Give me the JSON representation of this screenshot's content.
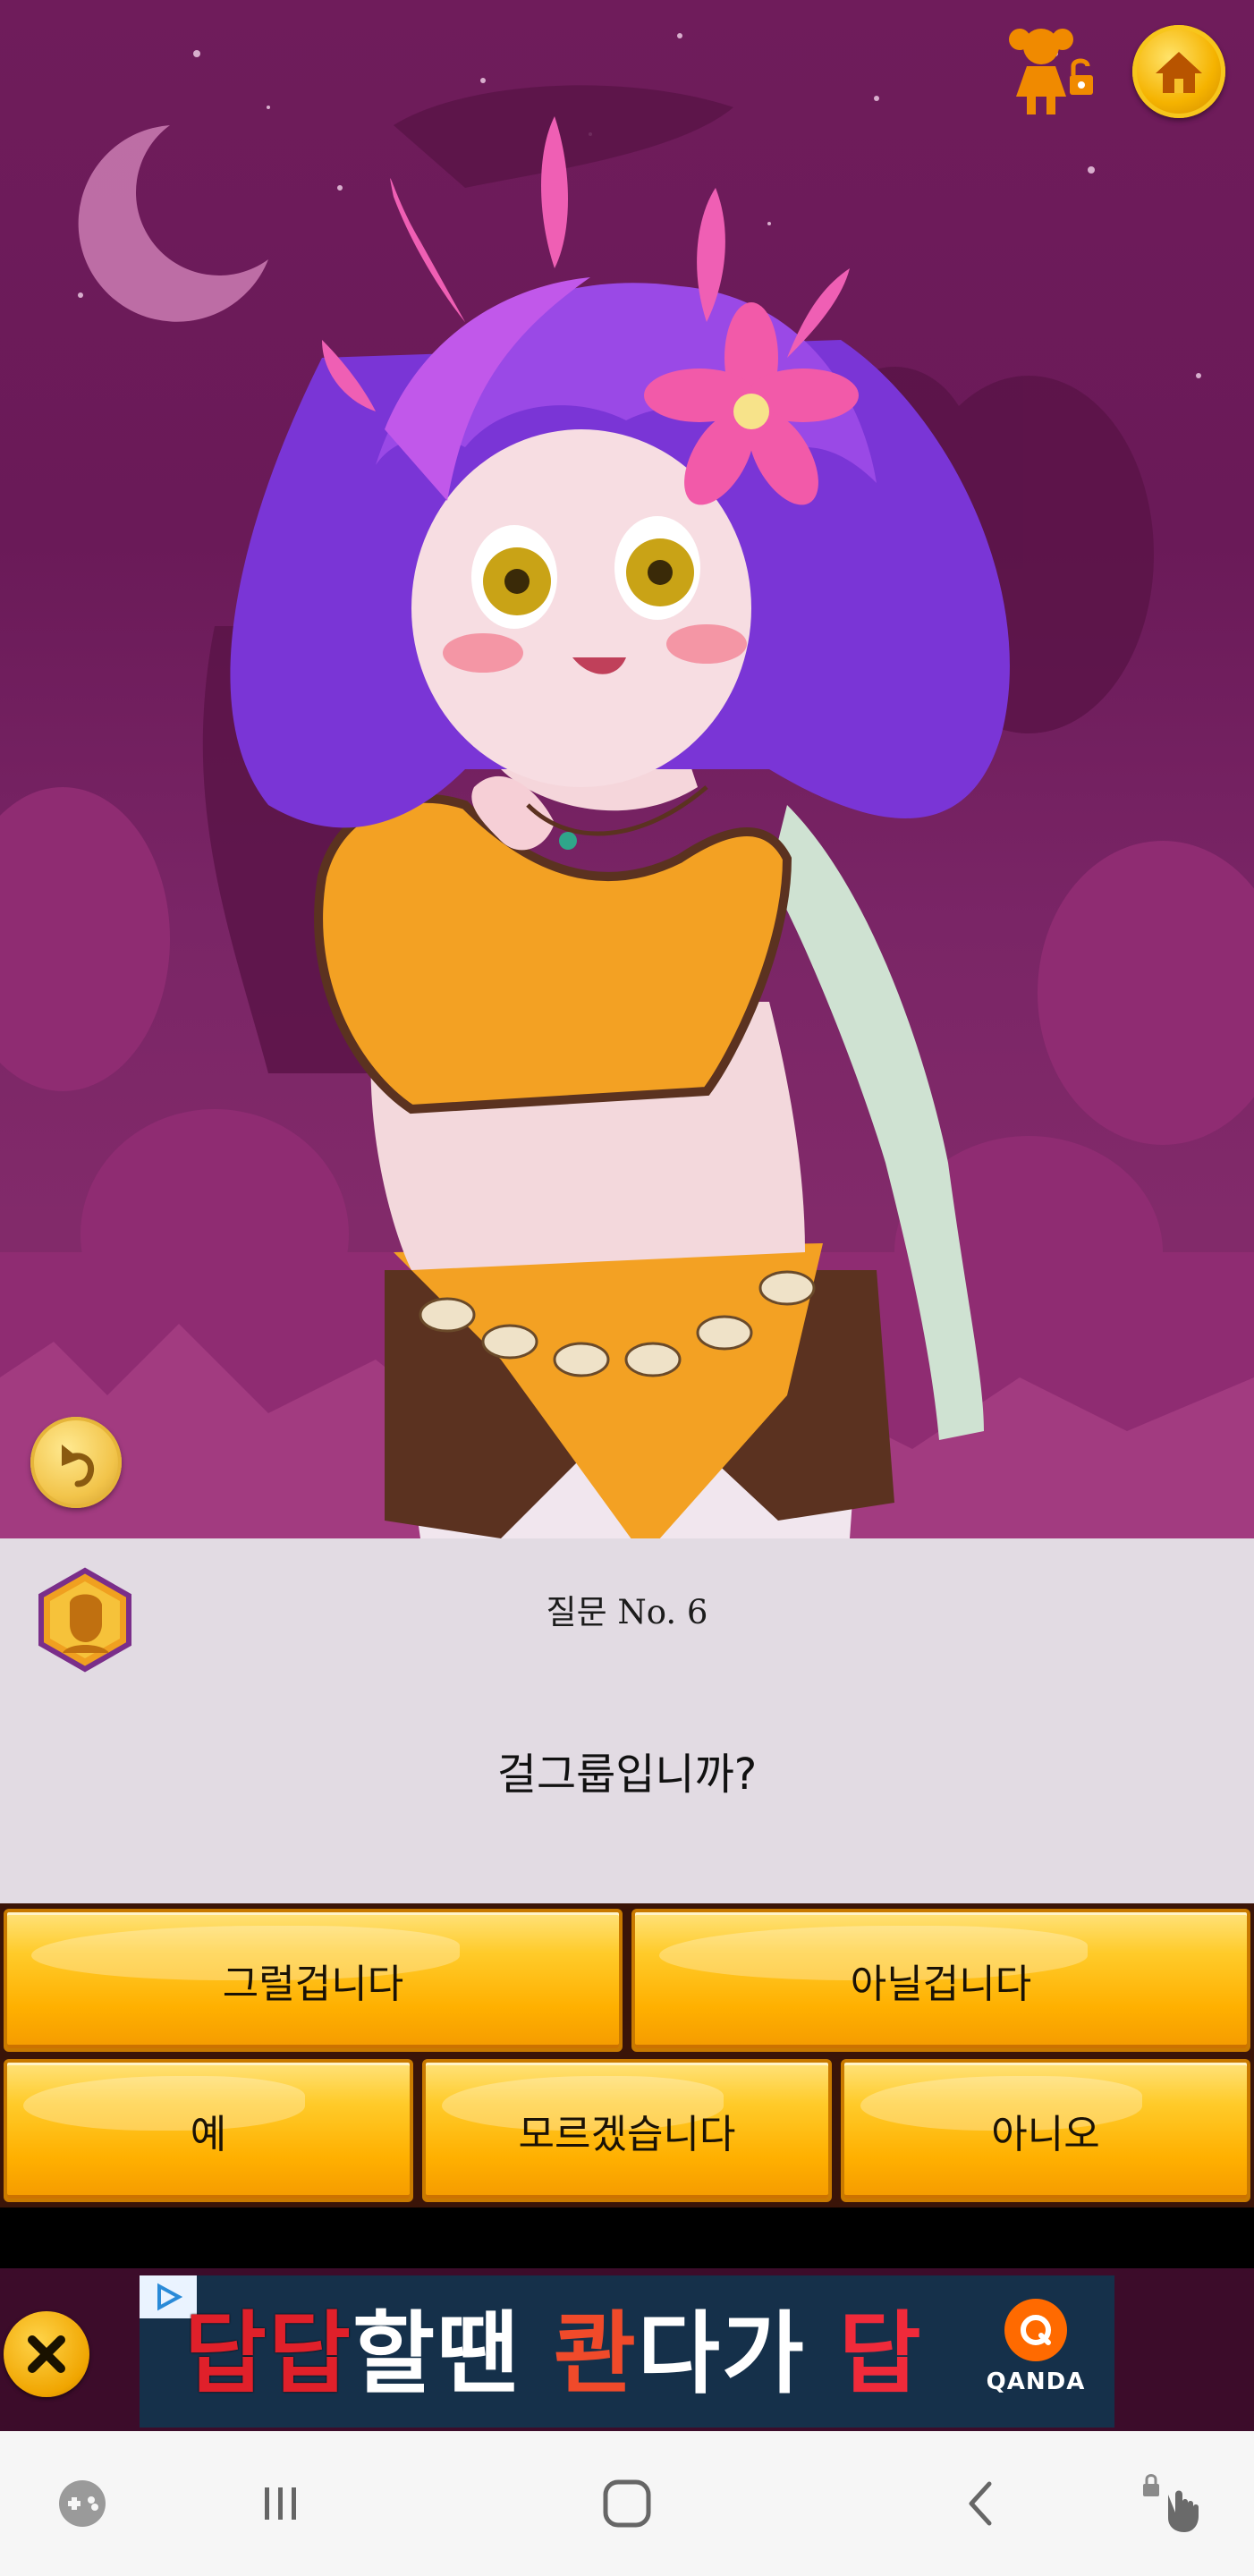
{
  "question": {
    "number_label": "질문 No. 6",
    "text": "걸그룹입니까?"
  },
  "answers": {
    "probably_yes": "그럴겁니다",
    "probably_no": "아닐겁니다",
    "yes": "예",
    "dont_know": "모르겠습니다",
    "no": "아니오"
  },
  "ad": {
    "headline_parts": [
      "답답",
      "할땐 ",
      "콴",
      "다가 ",
      "답"
    ],
    "brand": "QANDA"
  },
  "icons": {
    "home": "home-icon",
    "character": "character-lock-icon",
    "back": "undo-icon",
    "profile": "profile-badge-icon",
    "close_ad": "close-icon",
    "ad_choices": "ad-choices-icon"
  },
  "colors": {
    "scene_purple": "#6f1c5b",
    "button_orange": "#ffb000",
    "panel": "#f3ecf4"
  }
}
